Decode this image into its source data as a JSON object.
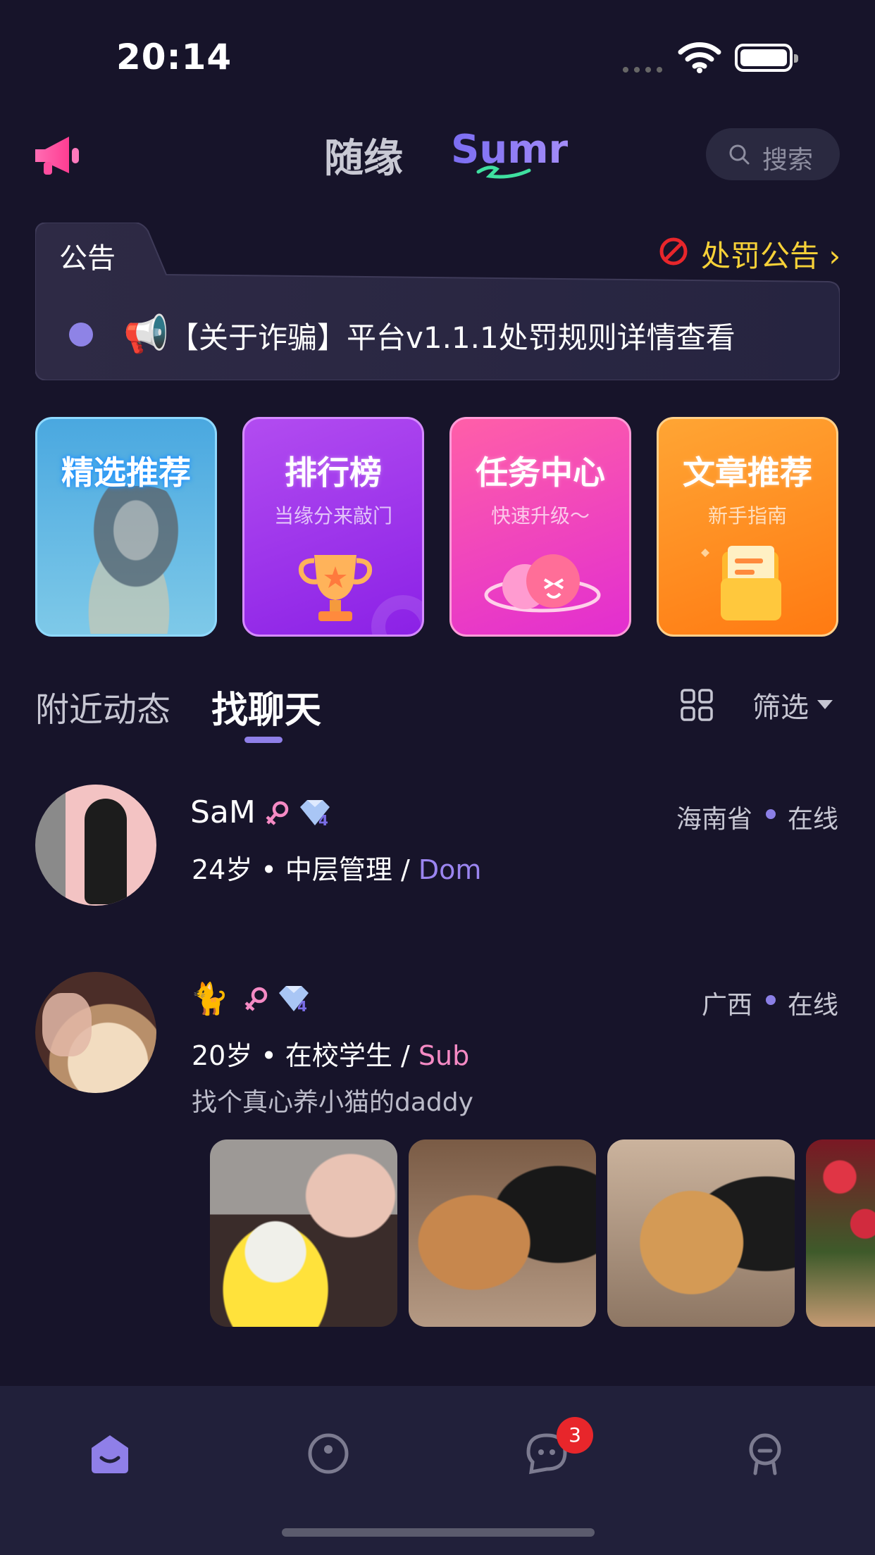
{
  "status_bar": {
    "time": "20:14"
  },
  "header": {
    "tabs": [
      {
        "label": "随缘"
      },
      {
        "label": "Sumr"
      }
    ],
    "search_label": "搜索"
  },
  "notice": {
    "title": "公告",
    "punish_label": "处罚公告",
    "punish_chevron": "›",
    "horn": "📢",
    "text": "【关于诈骗】平台v1.1.1处罚规则详情查看"
  },
  "cards": [
    {
      "title": "精选推荐",
      "subtitle": ""
    },
    {
      "title": "排行榜",
      "subtitle": "当缘分来敲门"
    },
    {
      "title": "任务中心",
      "subtitle": "快速升级～"
    },
    {
      "title": "文章推荐",
      "subtitle": "新手指南"
    }
  ],
  "section_tabs": [
    {
      "label": "附近动态"
    },
    {
      "label": "找聊天"
    }
  ],
  "filter_label": "筛选",
  "users": [
    {
      "name": "SaM",
      "level": "4",
      "location": "海南省",
      "status": "在线",
      "meta": "24岁 • 中层管理 / ",
      "role": "Dom",
      "bio": ""
    },
    {
      "name": "🐈",
      "level": "4",
      "location": "广西",
      "status": "在线",
      "meta": "20岁 • 在校学生 / ",
      "role": "Sub",
      "bio": "找个真心养小猫的daddy"
    }
  ],
  "bottom_nav": {
    "items": [
      {
        "icon": "home-icon"
      },
      {
        "icon": "discover-icon"
      },
      {
        "icon": "message-icon"
      },
      {
        "icon": "profile-icon"
      }
    ],
    "message_badge": "3"
  },
  "colors": {
    "background": "#17142a",
    "accent": "#8f7fe8",
    "dom_color": "#9b85f0",
    "sub_color": "#f58ac4",
    "punish_color": "#f7d138"
  }
}
